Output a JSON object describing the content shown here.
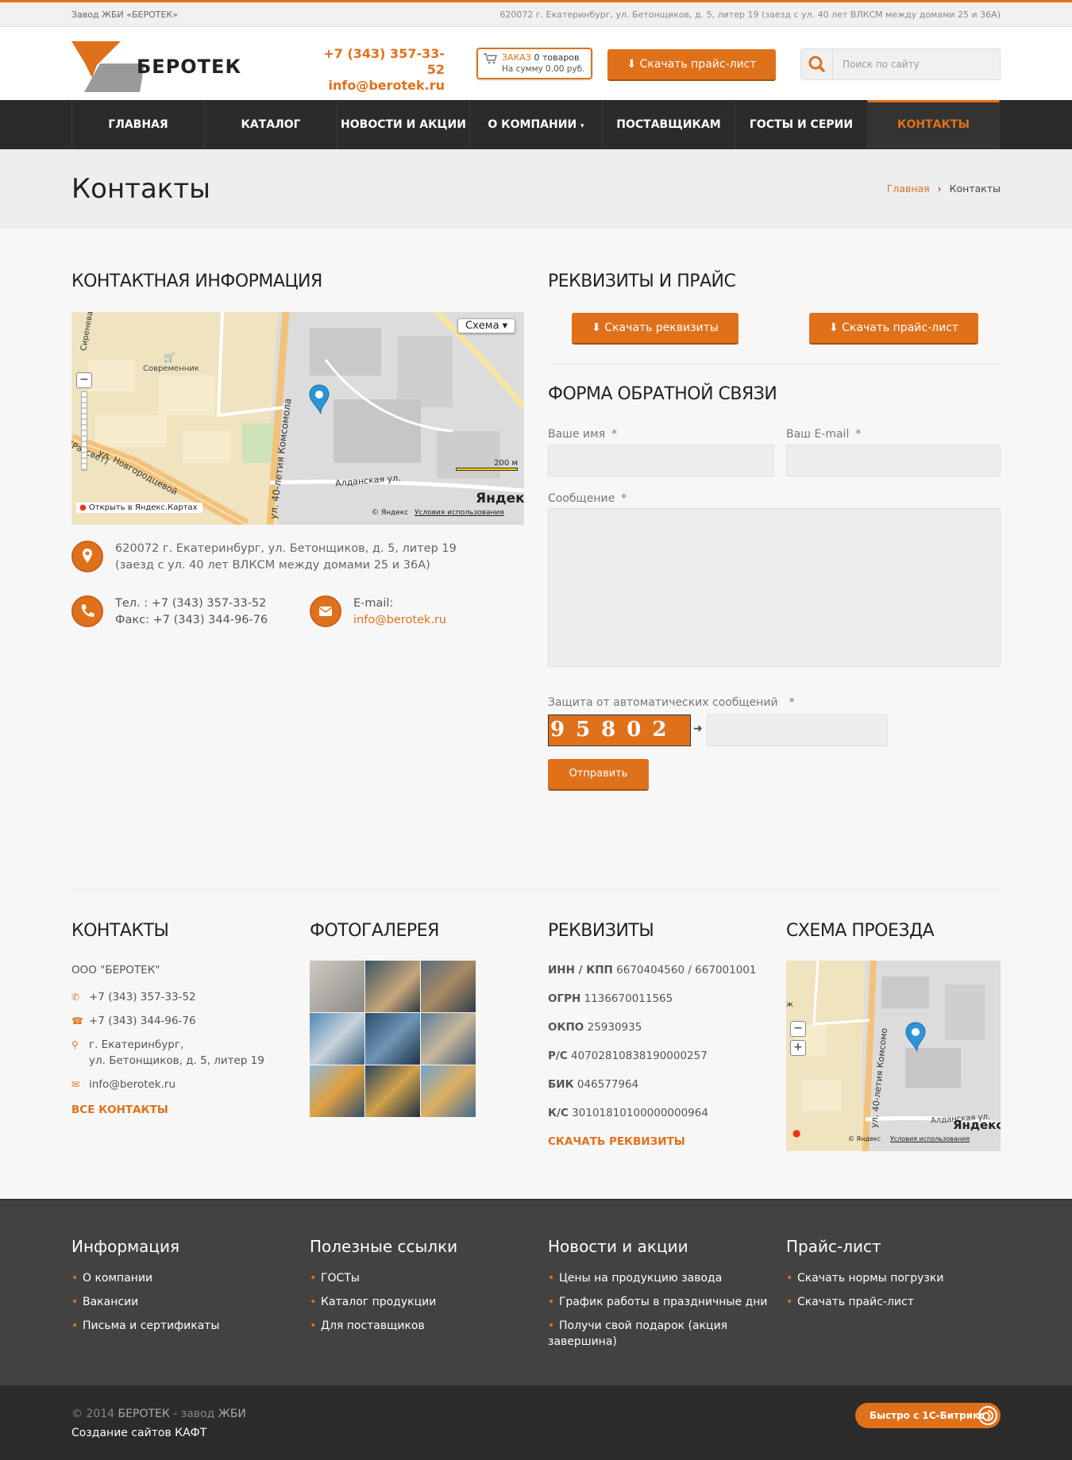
{
  "topbar": {
    "left": "Завод ЖБИ «БЕРОТЕК»",
    "right": "620072 г. Екатеринбург, ул. Бетонщиков, д. 5, литер 19 (заезд с ул. 40 лет ВЛКСМ между домами 25 и 36А)"
  },
  "header": {
    "logo_text": "БЕРОТЕК",
    "phone": "+7 (343) 357-33-52",
    "email": "info@berotek.ru",
    "cart_label": "ЗАКАЗ",
    "cart_count": "0 товаров",
    "cart_sum": "На сумму 0.00 руб.",
    "price_button": "⬇ Скачать прайс-лист",
    "search_placeholder": "Поиск по сайту"
  },
  "nav": {
    "items": [
      {
        "label": "ГЛАВНАЯ"
      },
      {
        "label": "КАТАЛОГ"
      },
      {
        "label": "НОВОСТИ И АКЦИИ"
      },
      {
        "label": "О КОМПАНИИ"
      },
      {
        "label": "ПОСТАВЩИКАМ"
      },
      {
        "label": "ГОСТЫ И СЕРИИ"
      },
      {
        "label": "КОНТАКТЫ"
      }
    ]
  },
  "page": {
    "title": "Контакты",
    "breadcrumb_home": "Главная",
    "breadcrumb_sep": "›",
    "breadcrumb_current": "Контакты"
  },
  "contact_info": {
    "heading": "КОНТАКТНАЯ ИНФОРМАЦИЯ",
    "map_type": "Схема ▾",
    "map_open": "Открыть в Яндекс.Картах",
    "map_scale": "200 м",
    "map_copyright": "© Яндекс",
    "map_terms": "Условия использования",
    "map_brand": "Яндекс",
    "map_labels": {
      "street1": "ул. 40-летия Комсомола",
      "street2": "Алданская ул.",
      "street3": "ул. Новгородцевой",
      "street4": "Сиренева",
      "poi": "Современник",
      "street5": "(Рассвет)"
    },
    "address_line1": "620072 г. Екатеринбург, ул. Бетонщиков, д. 5, литер 19",
    "address_line2": "(заезд с ул. 40 лет ВЛКСМ между домами 25 и 36А)",
    "tel": "Тел. : +7 (343) 357-33-52",
    "fax": "Факс: +7 (343) 344-96-76",
    "email_label": "E-mail:",
    "email": "info@berotek.ru"
  },
  "requisites": {
    "heading": "РЕКВИЗИТЫ И ПРАЙС",
    "btn_req": "⬇ Скачать реквизиты",
    "btn_price": "⬇ Скачать прайс-лист"
  },
  "form": {
    "heading": "ФОРМА ОБРАТНОЙ СВЯЗИ",
    "name_label": "Ваше имя",
    "email_label": "Ваш E-mail",
    "message_label": "Сообщение",
    "required_mark": "*",
    "captcha_label": "Защита от автоматических сообщений",
    "captcha_code": "95802",
    "captcha_arrow": "➜",
    "submit": "Отправить"
  },
  "footer_contacts": {
    "heading": "КОНТАКТЫ",
    "company": "ООО \"БЕРОТЕК\"",
    "phone": "+7 (343) 357-33-52",
    "fax": "+7 (343) 344-96-76",
    "addr1": "г. Екатеринбург,",
    "addr2": "ул. Бетонщиков, д. 5, литер 19",
    "email": "info@berotek.ru",
    "all_link": "ВСЕ КОНТАКТЫ"
  },
  "footer_gallery": {
    "heading": "ФОТОГАЛЕРЕЯ"
  },
  "footer_req": {
    "heading": "РЕКВИЗИТЫ",
    "rows": [
      {
        "k": "ИНН / КПП",
        "v": "6670404560 / 667001001"
      },
      {
        "k": "ОГРН",
        "v": "1136670011565"
      },
      {
        "k": "ОКПО",
        "v": "25930935"
      },
      {
        "k": "Р/С",
        "v": "40702810838190000257"
      },
      {
        "k": "БИК",
        "v": "046577964"
      },
      {
        "k": "К/С",
        "v": "30101810100000000964"
      }
    ],
    "link": "СКАЧАТЬ РЕКВИЗИТЫ"
  },
  "footer_map": {
    "heading": "СХЕМА ПРОЕЗДА",
    "street1": "ул. 40-летия Комсомо",
    "street2": "Алданская ул.",
    "copyright": "© Яндекс",
    "terms": "Условия использования",
    "brand": "Яндекс",
    "edge": "ж"
  },
  "dark_footer": {
    "col1": {
      "title": "Информация",
      "items": [
        "О компании",
        "Вакансии",
        "Письма и сертификаты"
      ]
    },
    "col2": {
      "title": "Полезные ссылки",
      "items": [
        "ГОСТы",
        "Каталог продукции",
        "Для поставщиков"
      ]
    },
    "col3": {
      "title": "Новости и акции",
      "items": [
        "Цены на продукцию завода",
        "График работы в праздничные дни",
        "Получи свой подарок (акция",
        "завершина)"
      ]
    },
    "col4": {
      "title": "Прайс-лист",
      "items": [
        "Скачать нормы погрузки",
        "Скачать прайс-лист"
      ]
    }
  },
  "bottom": {
    "copyright_prefix": "© 2014",
    "copyright_brand": "БЕРОТЕК",
    "copyright_sep": "- завод",
    "copyright_tail": "ЖБИ",
    "made_by": "Создание сайтов КАФТ",
    "bitrix": "Быстро с 1С-Битрикс"
  },
  "colors": {
    "accent": "#e0711b",
    "nav_bg": "#2b2b2b",
    "footer_bg": "#424242"
  }
}
